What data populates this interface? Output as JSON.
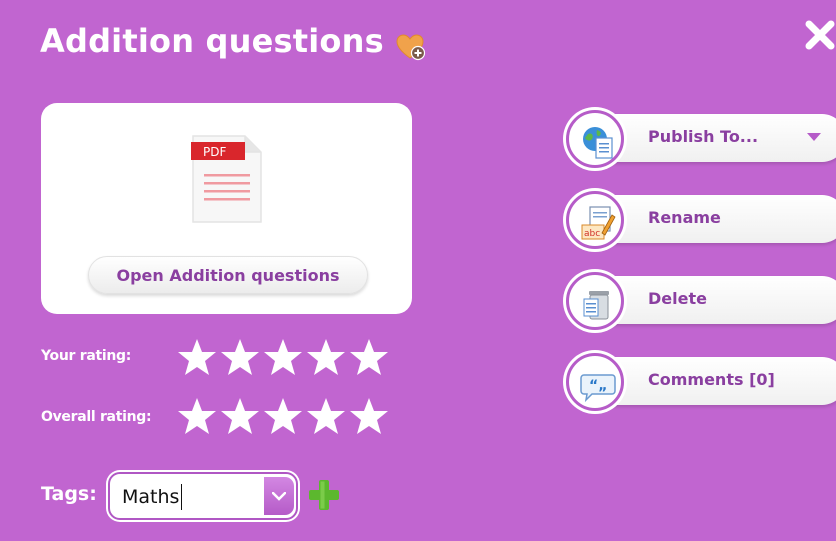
{
  "title": "Addition questions",
  "icons": {
    "favourite": "heart-plus-icon",
    "close": "close-icon",
    "file": "pdf-file-icon",
    "star": "star-icon",
    "add_tag": "plus-icon",
    "publish": "globe-document-icon",
    "rename": "rename-abc-icon",
    "delete": "trash-icon",
    "comments": "speech-bubble-icon"
  },
  "file_card": {
    "file_type": "PDF",
    "open_label": "Open Addition questions"
  },
  "ratings": {
    "your_label": "Your rating:",
    "overall_label": "Overall rating:",
    "your_value": 0,
    "overall_value": 0,
    "max": 5
  },
  "tags": {
    "label": "Tags:",
    "value": "Maths"
  },
  "actions": {
    "publish_label": "Publish To...",
    "rename_label": "Rename",
    "delete_label": "Delete",
    "comments_label": "Comments [0]"
  },
  "colors": {
    "background": "#c165d0",
    "accent_text": "#8a3fa0",
    "pdf_red": "#d9262c",
    "add_green": "#5cb82e",
    "heart_orange": "#f0a24b"
  }
}
